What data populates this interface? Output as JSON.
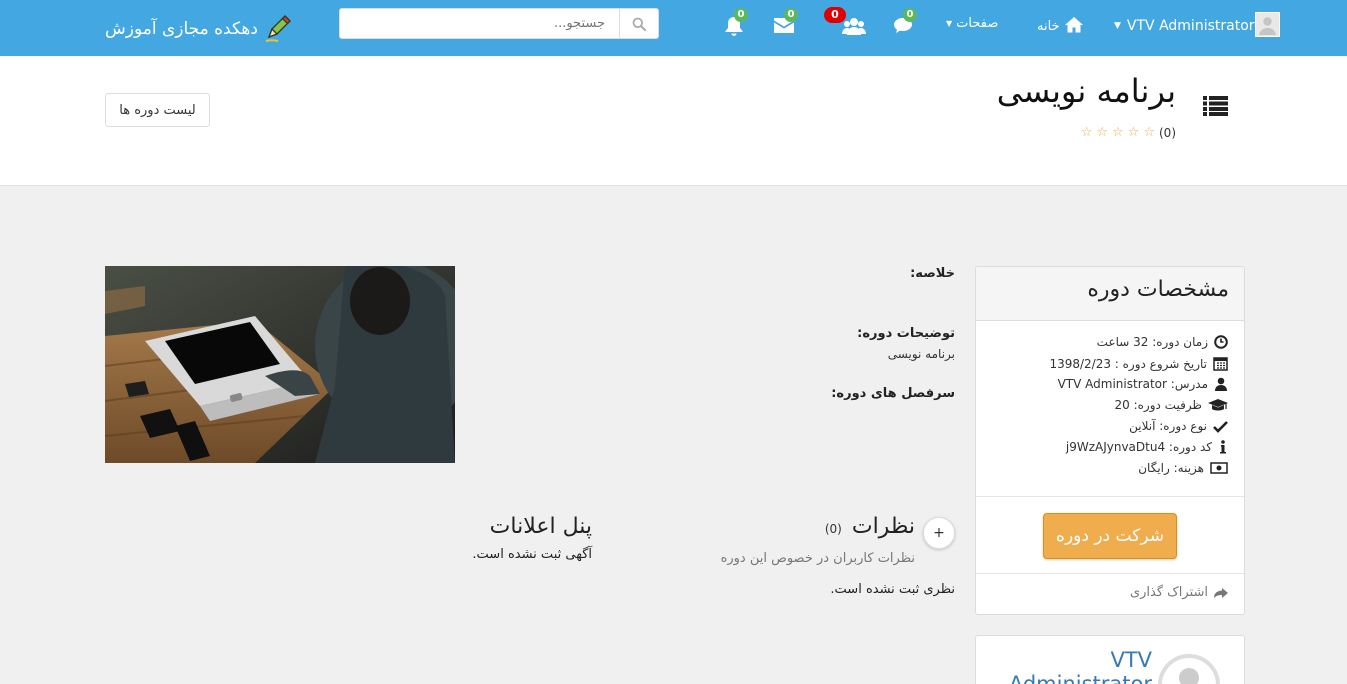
{
  "navbar": {
    "brand": "دهکده مجازی آموزش",
    "search_placeholder": "جستجو...",
    "user_name": "VTV Administrator",
    "home_label": "خانه",
    "pages_label": "صفحات",
    "badges": {
      "notifications": "0",
      "messages": "0",
      "friend_requests": "0",
      "chat": "0"
    },
    "colors": {
      "bar": "#43a7e1",
      "badge_green": "#5cb85c",
      "badge_red": "#e00000"
    }
  },
  "header": {
    "title": "برنامه نویسی",
    "rating_count": "(0)",
    "course_list_button": "لیست دوره ها"
  },
  "specs": {
    "title": "مشخصات دوره",
    "rows": [
      {
        "icon": "clock-icon",
        "text": "زمان دوره: 32 ساعت"
      },
      {
        "icon": "calendar-icon",
        "text": "تاریخ شروع دوره : 1398/2/23"
      },
      {
        "icon": "user-icon",
        "text": "مدرس: VTV Administrator"
      },
      {
        "icon": "graduation-cap-icon",
        "text": "ظرفیت دوره: 20"
      },
      {
        "icon": "check-icon",
        "text": "نوع دوره: آنلاین"
      },
      {
        "icon": "info-icon",
        "text": "کد دوره: j9WzAJynvaDtu4"
      },
      {
        "icon": "money-icon",
        "text": "هزینه: رایگان"
      }
    ],
    "enroll_button": "شرکت در دوره",
    "share_label": "اشتراک گذاری"
  },
  "instructor": {
    "name_line1": "VTV",
    "name_line2": "Administrator"
  },
  "description": {
    "summary_label": "خلاصه:",
    "desc_label": "توضیحات دوره:",
    "desc_value": "برنامه نویسی",
    "syllabus_label": "سرفصل های دوره:"
  },
  "comments": {
    "title": "نظرات",
    "count": "(0)",
    "add_label": "+",
    "subtitle": "نظرات کاربران در خصوص این دوره",
    "empty": "نظری ثبت نشده است."
  },
  "announcements": {
    "title": "پنل اعلانات",
    "empty": "آگهی ثبت نشده است."
  }
}
